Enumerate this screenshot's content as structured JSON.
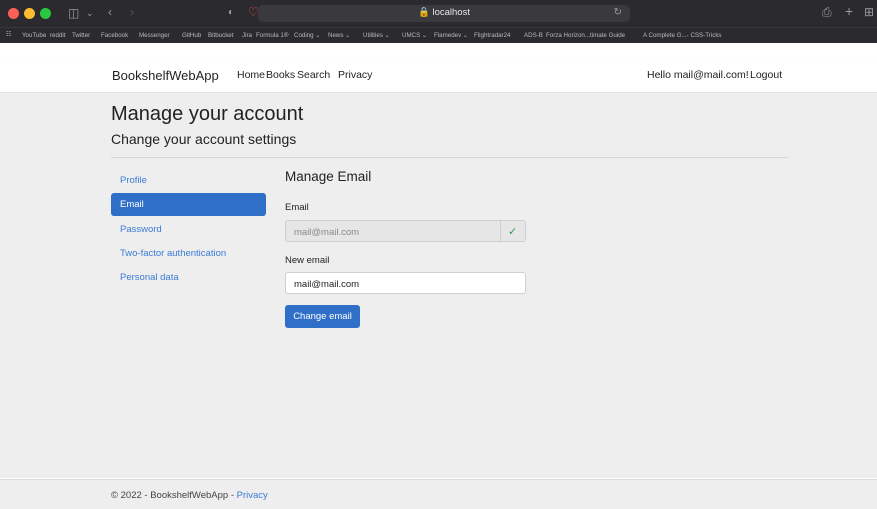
{
  "browser": {
    "address": "localhost",
    "bookmarks": [
      "YouTube",
      "reddit",
      "Twitter",
      "Facebook",
      "Messenger",
      "GitHub",
      "Bitbucket",
      "Jira",
      "Formula 1®",
      "Coding ⌄",
      "News ⌄",
      "Utilities ⌄",
      "UMCS ⌄",
      "Flamedev ⌄",
      "Flightradar24",
      "ADS-B",
      "Forza Horizon...timate Guide",
      "A Complete G...- CSS-Tricks"
    ]
  },
  "navbar": {
    "brand": "BookshelfWebApp",
    "links": [
      "Home",
      "Books",
      "Search",
      "Privacy"
    ],
    "greeting": "Hello mail@mail.com!",
    "logout": "Logout"
  },
  "page": {
    "title": "Manage your account",
    "subtitle": "Change your account settings"
  },
  "sidebar": {
    "items": [
      {
        "label": "Profile",
        "active": false
      },
      {
        "label": "Email",
        "active": true
      },
      {
        "label": "Password",
        "active": false
      },
      {
        "label": "Two-factor authentication",
        "active": false
      },
      {
        "label": "Personal data",
        "active": false
      }
    ]
  },
  "form": {
    "title": "Manage Email",
    "email_label": "Email",
    "email_value": "mail@mail.com",
    "verified_icon": "check-icon",
    "new_email_label": "New email",
    "new_email_value": "mail@mail.com",
    "submit_label": "Change email"
  },
  "footer": {
    "text": "© 2022 - BookshelfWebApp - ",
    "link": "Privacy"
  },
  "colors": {
    "accent": "#2f6fc7",
    "link": "#3b7bd6",
    "success": "#2a9d4a"
  }
}
